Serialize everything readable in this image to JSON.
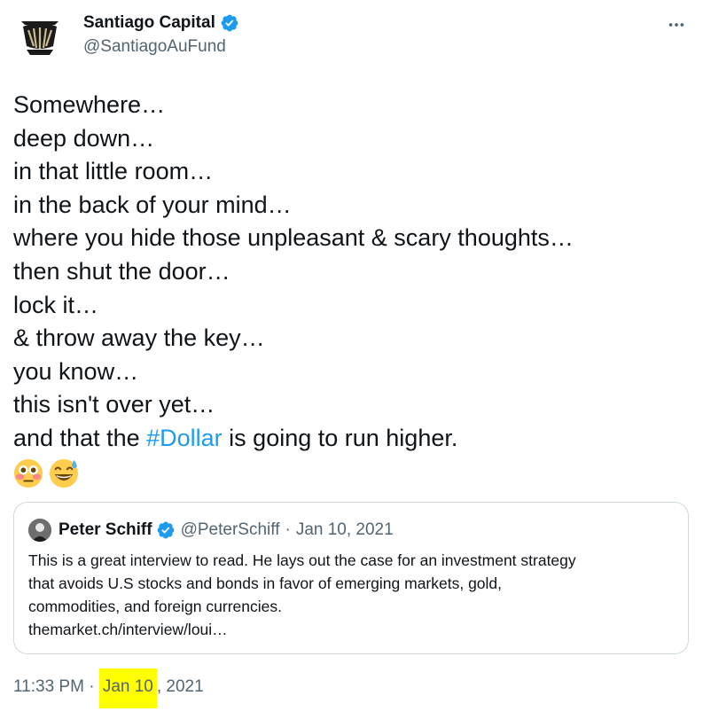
{
  "author": {
    "name": "Santiago Capital",
    "handle": "@SantiagoAuFund",
    "avatar_icon": "santiago-shell-logo-icon",
    "verified_icon": "verified-badge-icon"
  },
  "more_icon": "more-options-icon",
  "tweet": {
    "lines": [
      "Somewhere…",
      "deep down…",
      "in that little room…",
      "in the back of your mind…",
      "where you hide those unpleasant & scary thoughts…",
      "then shut the door…",
      "lock it…",
      "& throw away the key…",
      "you know…",
      "this isn't over yet…"
    ],
    "last_line_pre": "and that the ",
    "hashtag": "#Dollar",
    "last_line_post": " is going to run higher.",
    "emojis": [
      "flushed-face-emoji",
      "sweat-smile-emoji"
    ]
  },
  "quote": {
    "name": "Peter Schiff",
    "handle": "@PeterSchiff",
    "separator": "·",
    "date": "Jan 10, 2021",
    "body_lines": [
      "This is a great interview to read. He lays out the case for an investment strategy",
      "that avoids U.S stocks and bonds in favor of emerging markets, gold,",
      "commodities, and foreign currencies.",
      "themarket.ch/interview/loui…"
    ]
  },
  "meta": {
    "time": "11:33 PM",
    "separator": " · ",
    "date_highlighted": "Jan 10",
    "date_rest": ", 2021",
    "highlight_color": "#ffff00"
  },
  "colors": {
    "text": "#0f1419",
    "secondary": "#536471",
    "link": "#1d9bf0",
    "border": "#cfd9de"
  }
}
